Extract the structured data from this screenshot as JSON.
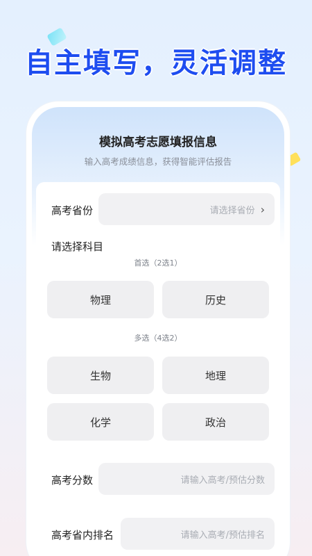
{
  "headline": "自主填写，灵活调整",
  "form": {
    "title": "模拟高考志愿填报信息",
    "subtitle": "输入高考成绩信息，获得智能评估报告",
    "province": {
      "label": "高考省份",
      "placeholder": "请选择省份"
    },
    "subjects": {
      "label": "请选择科目",
      "primary_hint": "首选（2选1）",
      "primary": [
        "物理",
        "历史"
      ],
      "multi_hint": "多选（4选2）",
      "multi": [
        "生物",
        "地理",
        "化学",
        "政治"
      ]
    },
    "score": {
      "label": "高考分数",
      "placeholder": "请输入高考/预估分数"
    },
    "rank": {
      "label": "高考省内排名",
      "placeholder": "请输入高考/预估排名"
    }
  }
}
